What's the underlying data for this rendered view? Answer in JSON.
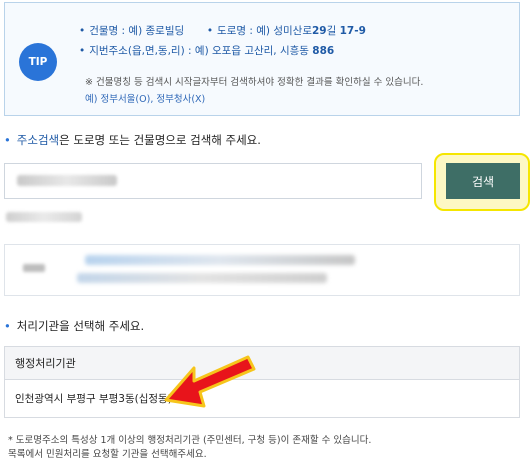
{
  "tip": {
    "badge": "TIP",
    "line1": {
      "building_label": "건물명 : ",
      "building_value_prefix": "예) ",
      "building_value": "종로빌딩",
      "road_label": "도로명 : ",
      "road_value_prefix": "예) 성미산로",
      "road_value_num": "29",
      "road_value_suffix": "길 ",
      "road_value_tail": "17-9"
    },
    "line2": {
      "lot_label": "지번주소(읍,면,동,리) : ",
      "lot_value_prefix": "예) 오포읍 고산리, 시흥동 ",
      "lot_value_num": "886"
    },
    "note": "※ 건물명칭 등 검색시 시작글자부터 검색하셔야 정확한 결과를 확인하실 수 있습니다.",
    "note_example": "예) 정부서울(O), 정부청사(X)"
  },
  "search_section": {
    "title_prefix": "주소검색",
    "title_suffix": "은 도로명 또는 건물명으로 검색해 주세요."
  },
  "search": {
    "button_label": "검색"
  },
  "agency_section": {
    "title": "처리기관을 선택해 주세요."
  },
  "table": {
    "header": "행정처리기관",
    "rows": [
      "인천광역시 부평구 부평3동(십정동)"
    ]
  },
  "footnotes": [
    "* 도로명주소의 특성상 1개 이상의 행정처리기관 (주민센터, 구청 등)이 존재할 수 있습니다.",
    "목록에서 민원처리를 요청할 기관을 선택해주세요."
  ],
  "colors": {
    "accent_blue": "#2a74d8",
    "search_button": "#3e6e66",
    "highlight_yellow": "#f5e600",
    "arrow_red": "#e8141b"
  }
}
